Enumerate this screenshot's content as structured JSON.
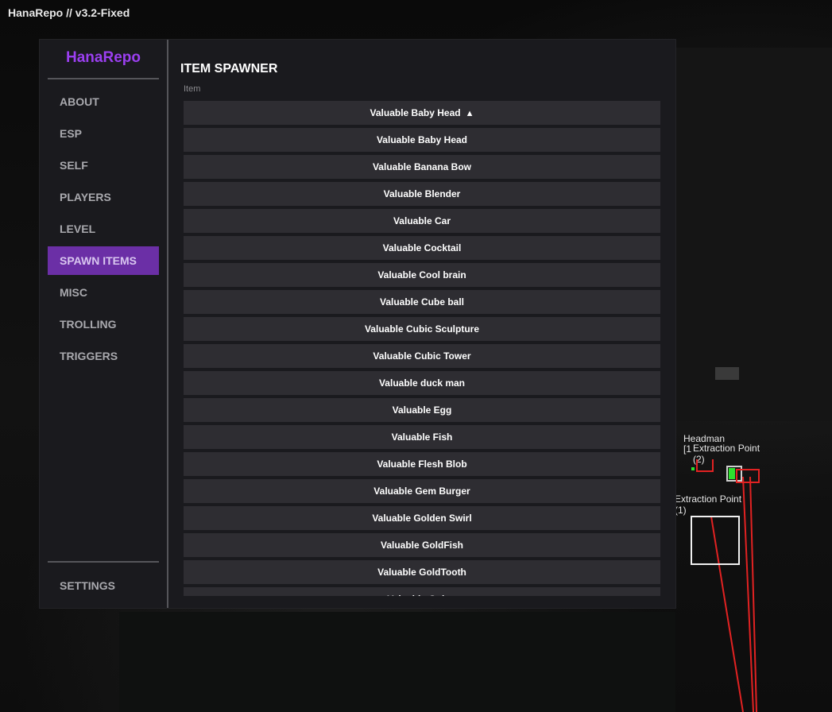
{
  "watermark": "HanaRepo // v3.2-Fixed",
  "sidebar": {
    "brand": "HanaRepo",
    "items": [
      {
        "label": "ABOUT",
        "active": false
      },
      {
        "label": "ESP",
        "active": false
      },
      {
        "label": "SELF",
        "active": false
      },
      {
        "label": "PLAYERS",
        "active": false
      },
      {
        "label": "LEVEL",
        "active": false
      },
      {
        "label": "SPAWN ITEMS",
        "active": true
      },
      {
        "label": "MISC",
        "active": false
      },
      {
        "label": "TROLLING",
        "active": false
      },
      {
        "label": "TRIGGERS",
        "active": false
      }
    ],
    "settings_label": "SETTINGS"
  },
  "colors": {
    "brand": "#9b3ff0",
    "active_nav": "#6b2fa6",
    "panel": "#1a1a1e",
    "item_button": "#2e2d32",
    "esp_line": "#e22222"
  },
  "spawner": {
    "title": "ITEM SPAWNER",
    "field_label": "Item",
    "selected": "Valuable Baby Head",
    "dropdown_arrow": "▲",
    "items": [
      "Valuable Baby Head",
      "Valuable Banana Bow",
      "Valuable Blender",
      "Valuable Car",
      "Valuable Cocktail",
      "Valuable Cool brain",
      "Valuable Cube ball",
      "Valuable Cubic Sculpture",
      "Valuable Cubic Tower",
      "Valuable duck man",
      "Valuable Egg",
      "Valuable Fish",
      "Valuable Flesh Blob",
      "Valuable Gem Burger",
      "Valuable Golden Swirl",
      "Valuable GoldFish",
      "Valuable GoldTooth",
      "Valuable Guitar"
    ]
  },
  "esp": {
    "headman_label": "Headman",
    "headman_tag": "[1",
    "extraction_2_label": "Extraction Point",
    "extraction_2_num": "(2)",
    "extraction_1_label": "Extraction Point",
    "extraction_1_num": "(1)"
  }
}
